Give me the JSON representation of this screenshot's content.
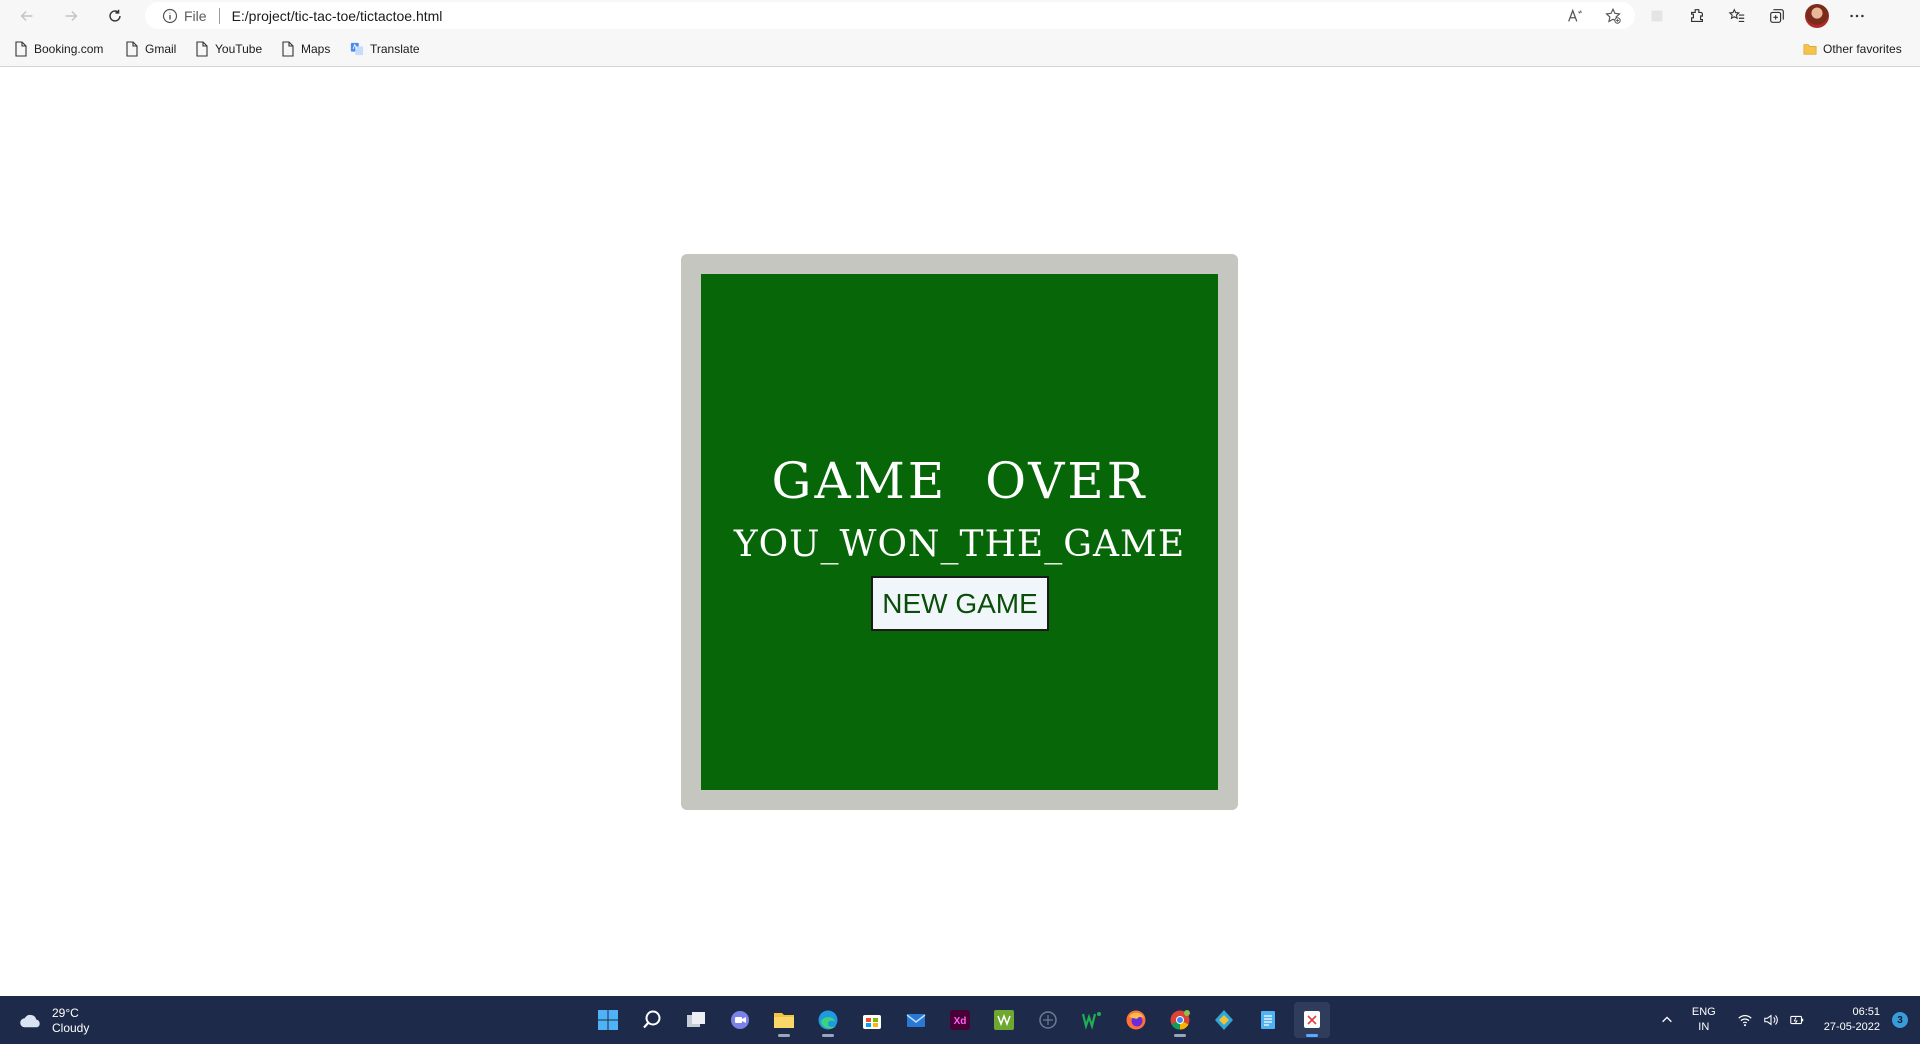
{
  "browser": {
    "address": {
      "scheme_label": "File",
      "url": "E:/project/tic-tac-toe/tictactoe.html"
    },
    "favorites": [
      {
        "label": "Booking.com",
        "icon": "page-icon"
      },
      {
        "label": "Gmail",
        "icon": "page-icon"
      },
      {
        "label": "YouTube",
        "icon": "page-icon"
      },
      {
        "label": "Maps",
        "icon": "page-icon"
      },
      {
        "label": "Translate",
        "icon": "translate-icon"
      }
    ],
    "other_favorites": "Other favorites"
  },
  "game": {
    "title": "GAME  OVER",
    "result": "YOU_WON_THE_GAME",
    "new_game_label": "NEW GAME",
    "colors": {
      "board": "#076607",
      "frame": "#c6c6c0",
      "text": "#ffffff",
      "button_text": "#0b4e0b"
    }
  },
  "taskbar": {
    "weather": {
      "temp": "29°C",
      "condition": "Cloudy"
    },
    "apps": [
      "start-icon",
      "search-icon",
      "task-view-icon",
      "teams-chat-icon",
      "file-explorer-icon",
      "edge-icon",
      "store-icon",
      "mail-icon",
      "adobe-xd-icon",
      "app-icon",
      "vscode-like-icon",
      "word-like-icon",
      "firefox-icon",
      "chrome-icon",
      "vpn-icon",
      "notepad-icon",
      "snipping-icon"
    ],
    "lang": {
      "line1": "ENG",
      "line2": "IN"
    },
    "time": "06:51",
    "date": "27-05-2022",
    "notification_count": "3"
  }
}
